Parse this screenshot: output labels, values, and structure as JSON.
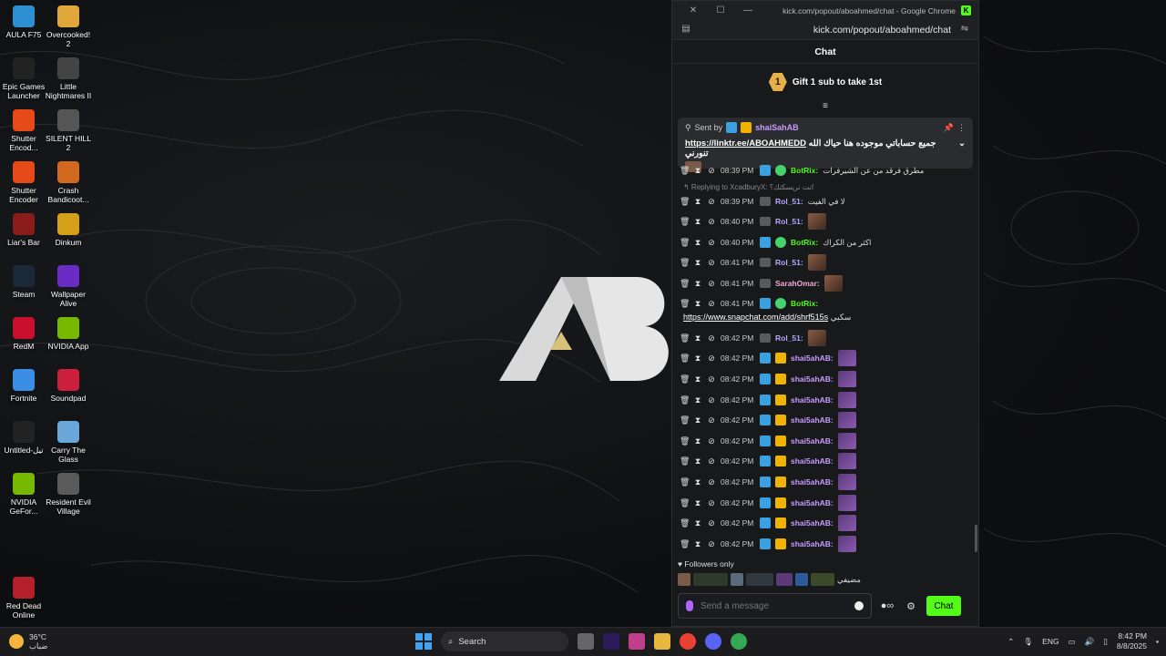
{
  "desktop": {
    "icons": [
      {
        "label": "AULA F75",
        "color": "#2c8fd1"
      },
      {
        "label": "Overcooked! 2",
        "color": "#e0a73a"
      },
      {
        "label": "Epic Games Launcher",
        "color": "#222"
      },
      {
        "label": "Little Nightmares II",
        "color": "#444"
      },
      {
        "label": "Shutter Encod...",
        "color": "#e64a19"
      },
      {
        "label": "SILENT HILL 2",
        "color": "#555"
      },
      {
        "label": "Shutter Encoder",
        "color": "#e64a19"
      },
      {
        "label": "Crash Bandicoot...",
        "color": "#d2691e"
      },
      {
        "label": "Liar's Bar",
        "color": "#8b1c1c"
      },
      {
        "label": "Dinkum",
        "color": "#d4a017"
      },
      {
        "label": "Steam",
        "color": "#1b2838"
      },
      {
        "label": "Wallpaper Alive",
        "color": "#6a2cc4"
      },
      {
        "label": "RedM",
        "color": "#c8102e"
      },
      {
        "label": "NVIDIA App",
        "color": "#76b900"
      },
      {
        "label": "Fortnite",
        "color": "#3a8ee6"
      },
      {
        "label": "Soundpad",
        "color": "#cc1f3b"
      },
      {
        "label": "Untitled-تيل",
        "color": "#222"
      },
      {
        "label": "Carry The Glass",
        "color": "#6aa6d8"
      },
      {
        "label": "NVIDIA GeFor...",
        "color": "#76b900"
      },
      {
        "label": "Resident Evil Village",
        "color": "#5a5a5a"
      },
      {
        "label": "Red Dead Online",
        "color": "#b3202a"
      }
    ]
  },
  "window": {
    "title": "kick.com/popout/aboahmed/chat - Google Chrome",
    "url": "kick.com/popout/aboahmed/chat",
    "kick_badge": "K",
    "chat_header": "Chat",
    "gift_rank": "1",
    "gift_text": "Gift 1 sub to take 1st"
  },
  "pinned": {
    "sent_by": "Sent by",
    "user": "shaiSahAB",
    "message": "جميع حساباتي موجوده هنا حياك الله تنورني",
    "link": "https://linktr.ee/ABOAHMEDD"
  },
  "chat": {
    "partial_top": {
      "time": "08:39 PM",
      "user": "BotRix:",
      "text": "مطرق فرقد من عن الشيرفرات"
    },
    "reply": "Replying to XcadburyX: انت تريسكتك؟",
    "messages": [
      {
        "time": "08:39 PM",
        "user": "Rol_51:",
        "text": "لا في الفيت",
        "ucls": "u-lavender",
        "badges": "og"
      },
      {
        "time": "08:40 PM",
        "user": "Rol_51:",
        "text": "",
        "ucls": "u-lavender",
        "badges": "og",
        "emote": "face"
      },
      {
        "time": "08:40 PM",
        "user": "BotRix:",
        "text": "اكثر من الكراك",
        "ucls": "u-green",
        "badges": "bot"
      },
      {
        "time": "08:41 PM",
        "user": "Rol_51:",
        "text": "",
        "ucls": "u-lavender",
        "badges": "og",
        "emote": "face"
      },
      {
        "time": "08:41 PM",
        "user": "SarahOmar:",
        "text": "",
        "ucls": "u-pink",
        "badges": "og",
        "emote": "face"
      },
      {
        "time": "08:41 PM",
        "user": "BotRix:",
        "text": "",
        "ucls": "u-green",
        "badges": "bot"
      }
    ],
    "snap_link": "https://www.snapchat.com/add/shrf515s",
    "snap_suffix": "سكبي",
    "messages2": [
      {
        "time": "08:42 PM",
        "user": "Rol_51:",
        "ucls": "u-lavender",
        "badges": "og",
        "emote": "face"
      },
      {
        "time": "08:42 PM",
        "user": "shai5ahAB:",
        "ucls": "u-purple",
        "badges": "sub",
        "emote": "purple"
      },
      {
        "time": "08:42 PM",
        "user": "shai5ahAB:",
        "ucls": "u-purple",
        "badges": "sub",
        "emote": "purple"
      },
      {
        "time": "08:42 PM",
        "user": "shai5ahAB:",
        "ucls": "u-purple",
        "badges": "sub",
        "emote": "purple"
      },
      {
        "time": "08:42 PM",
        "user": "shai5ahAB:",
        "ucls": "u-purple",
        "badges": "sub",
        "emote": "purple"
      },
      {
        "time": "08:42 PM",
        "user": "shai5ahAB:",
        "ucls": "u-purple",
        "badges": "sub",
        "emote": "purple"
      },
      {
        "time": "08:42 PM",
        "user": "shai5ahAB:",
        "ucls": "u-purple",
        "badges": "sub",
        "emote": "purple"
      },
      {
        "time": "08:42 PM",
        "user": "shai5ahAB:",
        "ucls": "u-purple",
        "badges": "sub",
        "emote": "purple"
      },
      {
        "time": "08:42 PM",
        "user": "shai5ahAB:",
        "ucls": "u-purple",
        "badges": "sub",
        "emote": "purple"
      },
      {
        "time": "08:42 PM",
        "user": "shai5ahAB:",
        "ucls": "u-purple",
        "badges": "sub",
        "emote": "purple"
      },
      {
        "time": "08:42 PM",
        "user": "shai5ahAB:",
        "ucls": "u-purple",
        "badges": "sub",
        "emote": "purple"
      }
    ]
  },
  "followers": {
    "label": "Followers only",
    "tail": "مضيفي"
  },
  "input": {
    "placeholder": "Send a message",
    "chat_button": "Chat"
  },
  "taskbar": {
    "weather_temp": "36°C",
    "weather_desc": "ضباب",
    "search_label": "Search",
    "lang": "ENG",
    "time": "8:42 PM",
    "date": "8/8/2025"
  },
  "colors": {
    "kick_green": "#53fc18",
    "sub_purple": "#c79bff",
    "bg": "#18191b"
  }
}
